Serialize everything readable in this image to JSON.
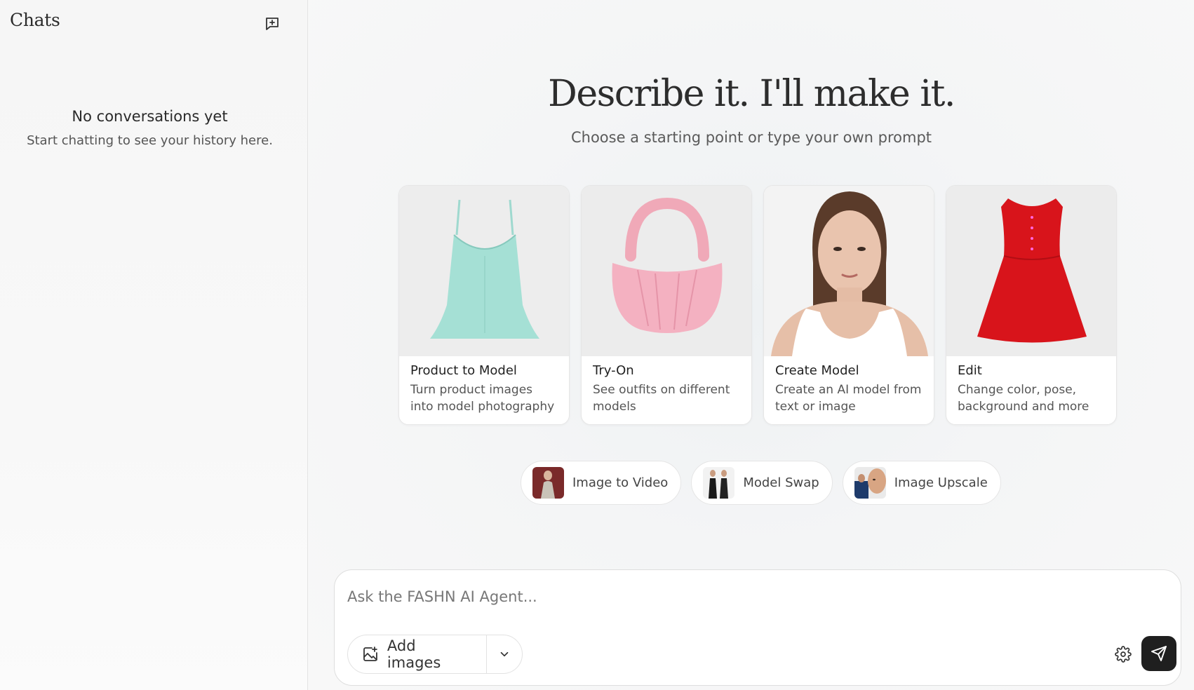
{
  "sidebar": {
    "title": "Chats",
    "new_chat_icon": "message-plus-icon",
    "empty_title": "No conversations yet",
    "empty_subtitle": "Start chatting to see your history here."
  },
  "main": {
    "headline": "Describe it. I'll make it.",
    "subheadline": "Choose a starting point or type your own prompt",
    "cards": [
      {
        "title": "Product to Model",
        "description": "Turn product images into model photography",
        "image": "mint-camisole"
      },
      {
        "title": "Try-On",
        "description": "See outfits on different models",
        "image": "pink-handbag"
      },
      {
        "title": "Create Model",
        "description": "Create an AI model from text or image",
        "image": "woman-portrait"
      },
      {
        "title": "Edit",
        "description": "Change color, pose, background and more",
        "image": "red-dress"
      }
    ],
    "chips": [
      {
        "label": "Image to Video",
        "image": "model-thumbnail"
      },
      {
        "label": "Model Swap",
        "image": "two-models-thumbnail"
      },
      {
        "label": "Image Upscale",
        "image": "face-thumbnail"
      }
    ]
  },
  "composer": {
    "placeholder": "Ask the FASHN AI Agent...",
    "add_images_label": "Add images",
    "icons": {
      "add_image": "image-plus-icon",
      "dropdown": "chevron-down-icon",
      "settings": "gear-icon",
      "send": "send-icon"
    },
    "send_color": "#1f1f1f"
  }
}
